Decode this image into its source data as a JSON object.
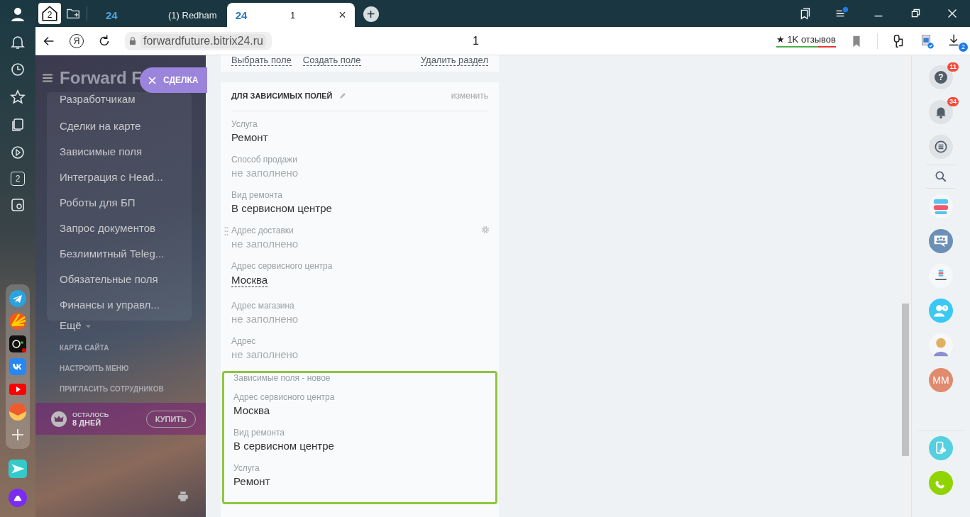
{
  "browser": {
    "home_badge": "2",
    "side_badge": "2",
    "tabs": [
      {
        "logo": "24",
        "selected": false
      },
      {
        "title": "(1) Redham",
        "selected": false
      },
      {
        "logo": "24",
        "title": "1",
        "selected": true
      }
    ],
    "close_tab": "×",
    "new_tab": "+",
    "address": {
      "yandex": "Я",
      "url": "forwardfuture.bitrix24.ru",
      "page_title": "1",
      "reviews": "★ 1K отзывов",
      "downloads_count": "2"
    }
  },
  "menu": {
    "title": "Forward F",
    "deal_button": "СДЕЛКА",
    "items": [
      "Разработчикам",
      "Сделки на карте",
      "Зависимые поля",
      "Интеграция с Head...",
      "Роботы для БП",
      "Запрос документов",
      "Безлимитный Teleg...",
      "Обязательные поля",
      "Финансы и управл..."
    ],
    "more": "Ещё",
    "links": [
      "КАРТА САЙТА",
      "НАСТРОИТЬ МЕНЮ",
      "ПРИГЛАСИТЬ СОТРУДНИКОВ"
    ],
    "trial": {
      "label": "ОСТАЛОСЬ",
      "days": "8 ДНЕЙ",
      "buy": "КУПИТЬ"
    }
  },
  "top_actions": [
    "Выбрать поле",
    "Создать поле",
    "Удалить раздел"
  ],
  "section": {
    "title": "ДЛЯ ЗАВИСИМЫХ ПОЛЕЙ",
    "edit": "изменить",
    "fields": [
      {
        "label": "Услуга",
        "value": "Ремонт",
        "kind": "filled",
        "hovered": false
      },
      {
        "label": "Способ продажи",
        "value": "не заполнено",
        "kind": "empty",
        "hovered": false
      },
      {
        "label": "Вид ремонта",
        "value": "В сервисном центре",
        "kind": "filled",
        "hovered": false
      },
      {
        "label": "Адрес доставки",
        "value": "не заполнено",
        "kind": "empty",
        "hovered": true
      },
      {
        "label": "Адрес сервисного центра",
        "value": "Москва",
        "kind": "link",
        "hovered": false
      },
      {
        "label": "Адрес магазина",
        "value": "не заполнено",
        "kind": "empty",
        "hovered": false
      },
      {
        "label": "Адрес",
        "value": "не заполнено",
        "kind": "empty",
        "hovered": false
      }
    ]
  },
  "group": {
    "title": "Зависимые поля - новое",
    "outlined": true,
    "fields": [
      {
        "label": "Адрес сервисного центра",
        "value": "Москва",
        "kind": "filled"
      },
      {
        "label": "Вид ремонта",
        "value": "В сервисном центре",
        "kind": "filled"
      },
      {
        "label": "Услуга",
        "value": "Ремонт",
        "kind": "filled"
      }
    ]
  },
  "right_panel": {
    "help_icon": "?",
    "help_count": "11",
    "notify_count": "34",
    "user_initials": "ММ"
  }
}
